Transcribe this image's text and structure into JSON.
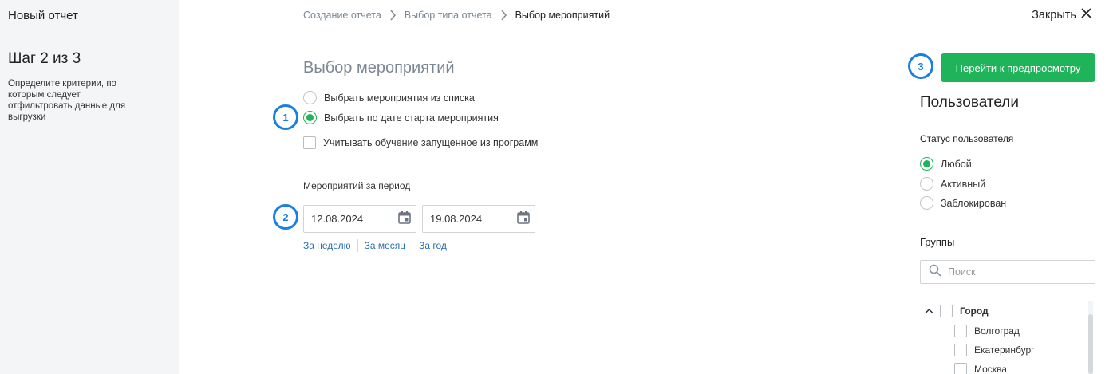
{
  "sidebar": {
    "title": "Новый отчет",
    "step": "Шаг 2 из 3",
    "description": "Определите критерии, по которым следует отфильтровать данные для выгрузки"
  },
  "breadcrumb": {
    "items": [
      "Создание отчета",
      "Выбор типа отчета"
    ],
    "current": "Выбор мероприятий"
  },
  "close_label": "Закрыть",
  "main": {
    "title": "Выбор мероприятий",
    "options": {
      "from_list": "Выбрать мероприятия из списка",
      "by_date": "Выбрать по дате старта мероприятия",
      "include_training": "Учитывать обучение запущенное из программ"
    },
    "selected_option": "by_date",
    "period_label": "Мероприятий за период",
    "date_from": "12.08.2024",
    "date_to": "19.08.2024",
    "quick_links": [
      "За неделю",
      "За месяц",
      "За год"
    ]
  },
  "badges": [
    "1",
    "2",
    "3"
  ],
  "right": {
    "preview_button": "Перейти к предпросмотру",
    "users_title": "Пользователи",
    "status_label": "Статус пользователя",
    "statuses": [
      "Любой",
      "Активный",
      "Заблокирован"
    ],
    "selected_status": "Любой",
    "groups_label": "Группы",
    "search_placeholder": "Поиск",
    "tree": {
      "parent": "Город",
      "children": [
        "Волгоград",
        "Екатеринбург",
        "Москва"
      ]
    }
  },
  "colors": {
    "accent_green": "#1fb35a",
    "badge_blue": "#1a7fe0",
    "link_blue": "#2a6fb3",
    "muted_gray": "#7b8794"
  }
}
